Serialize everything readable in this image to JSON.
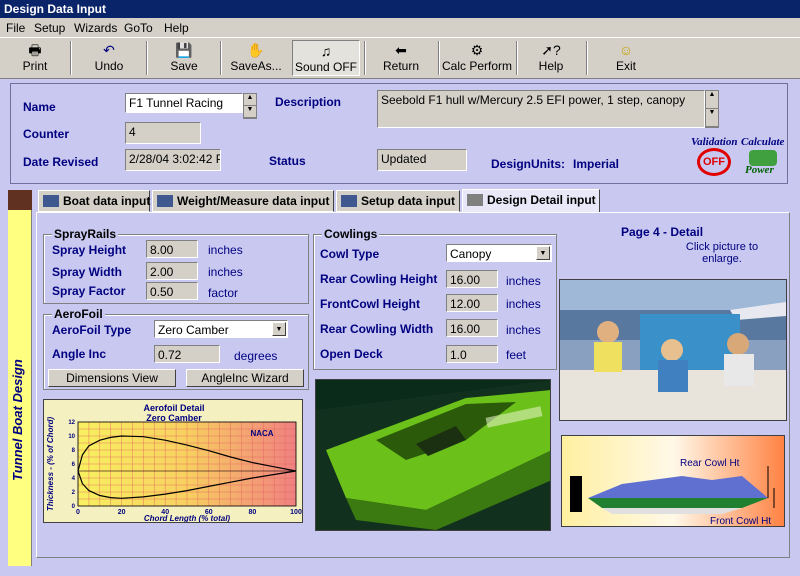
{
  "window": {
    "title": "Design Data Input"
  },
  "menu": [
    "File",
    "Setup",
    "Wizards",
    "GoTo",
    "Help"
  ],
  "toolbar": {
    "print": "Print",
    "undo": "Undo",
    "save": "Save",
    "save_as": "SaveAs...",
    "sound": "Sound OFF",
    "return": "Return",
    "calc": "Calc Perform",
    "help": "Help",
    "exit": "Exit"
  },
  "header": {
    "name_label": "Name",
    "name_value": "F1 Tunnel Racing",
    "counter_label": "Counter",
    "counter_value": "4",
    "date_label": "Date Revised",
    "date_value": "2/28/04 3:02:42 P",
    "desc_label": "Description",
    "desc_value": "Seebold F1 hull w/Mercury 2.5 EFI power, 1 step, canopy",
    "status_label": "Status",
    "status_value": "Updated",
    "units_label": "DesignUnits:",
    "units_value": "Imperial",
    "validation_label": "Validation",
    "validation_state": "OFF",
    "calc_label": "Calculate",
    "calc_sub": "Power"
  },
  "sidebar": {
    "text": "Tunnel Boat Design"
  },
  "tabs": [
    "Boat data input",
    "Weight/Measure data input",
    "Setup data input",
    "Design Detail input"
  ],
  "spray": {
    "title": "SprayRails",
    "height_label": "Spray Height",
    "height_value": "8.00",
    "height_unit": "inches",
    "width_label": "Spray Width",
    "width_value": "2.00",
    "width_unit": "inches",
    "factor_label": "Spray Factor",
    "factor_value": "0.50",
    "factor_unit": "factor"
  },
  "aerofoil": {
    "title": "AeroFoil",
    "type_label": "AeroFoil Type",
    "type_value": "Zero Camber",
    "angle_label": "Angle Inc",
    "angle_value": "0.72",
    "angle_unit": "degrees",
    "dim_button": "Dimensions View",
    "wizard_button": "AngleInc Wizard"
  },
  "cowlings": {
    "title": "Cowlings",
    "type_label": "Cowl Type",
    "type_value": "Canopy",
    "rear_h_label": "Rear Cowling Height",
    "rear_h_value": "16.00",
    "rear_h_unit": "inches",
    "front_h_label": "FrontCowl Height",
    "front_h_value": "12.00",
    "front_h_unit": "inches",
    "rear_w_label": "Rear Cowling Width",
    "rear_w_value": "16.00",
    "rear_w_unit": "inches",
    "deck_label": "Open Deck",
    "deck_value": "1.0",
    "deck_unit": "feet"
  },
  "detail": {
    "page_title": "Page 4 - Detail",
    "hint": "Click picture to enlarge.",
    "rear_cowl": "Rear Cowl Ht",
    "front_cowl": "Front Cowl Ht"
  },
  "chart_data": {
    "type": "line",
    "title": "Aerofoil Detail",
    "subtitle": "Zero Camber",
    "brand": "NACA",
    "xlabel": "Chord Length (% total)",
    "ylabel": "Thickness - (% of Chord)",
    "xlim": [
      0,
      100
    ],
    "ylim": [
      0,
      12
    ],
    "xticks": [
      0,
      20,
      40,
      60,
      80,
      100
    ],
    "yticks": [
      0,
      2,
      4,
      6,
      8,
      10,
      12
    ],
    "series": [
      {
        "x": [
          0,
          2,
          5,
          10,
          15,
          20,
          30,
          40,
          50,
          60,
          70,
          80,
          90,
          100
        ],
        "y": [
          5,
          7.3,
          8.6,
          9.4,
          9.8,
          10,
          9.9,
          9.4,
          8.7,
          7.9,
          7.0,
          6.2,
          5.6,
          5
        ]
      },
      {
        "x": [
          0,
          2,
          5,
          10,
          15,
          20,
          30,
          40,
          50,
          60,
          70,
          80,
          90,
          100
        ],
        "y": [
          5,
          3.2,
          2.2,
          1.5,
          1.2,
          1.1,
          1.3,
          1.7,
          2.2,
          2.8,
          3.4,
          4.0,
          4.5,
          5
        ]
      }
    ]
  }
}
